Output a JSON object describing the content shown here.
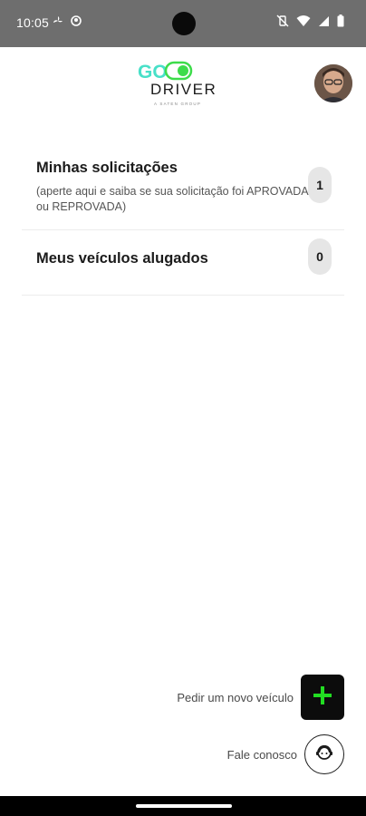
{
  "status_bar": {
    "time": "10:05",
    "left_icons": [
      "fan-icon",
      "app-icon"
    ],
    "right_icons": [
      "vibrate-off-icon",
      "wifi-icon",
      "signal-icon",
      "battery-icon"
    ]
  },
  "header": {
    "logo_text_top": "GO",
    "logo_text_bottom": "DRIVER",
    "logo_tagline": "A SATEN GROUP",
    "brand_green": "#3ddc4a",
    "brand_teal": "#48e0c8"
  },
  "list": {
    "items": [
      {
        "title": "Minhas solicitações",
        "subtitle": "(aperte aqui e saiba se sua solicitação foi APROVADA ou REPROVADA)",
        "count": "1"
      },
      {
        "title": "Meus veículos alugados",
        "count": "0"
      }
    ]
  },
  "actions": {
    "new_vehicle_label": "Pedir um novo veículo",
    "contact_label": "Fale conosco",
    "plus_color": "#22dd22"
  }
}
